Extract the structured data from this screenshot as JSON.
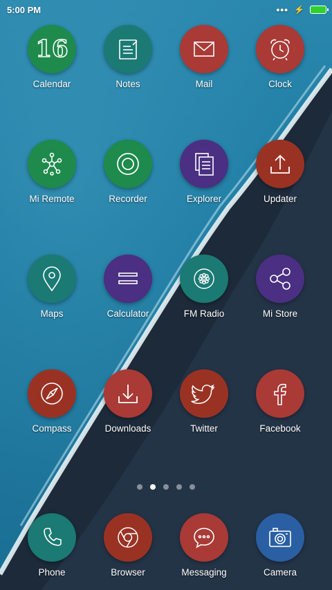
{
  "status_bar": {
    "time": "5:00 PM",
    "more": "•••"
  },
  "apps": [
    {
      "label": "Calendar",
      "icon": "calendar-icon",
      "color": "#1e8a4c",
      "number": "16"
    },
    {
      "label": "Notes",
      "icon": "notes-icon",
      "color": "#1b7a73"
    },
    {
      "label": "Mail",
      "icon": "mail-icon",
      "color": "#a93a36"
    },
    {
      "label": "Clock",
      "icon": "alarm-clock-icon",
      "color": "#a93a36"
    },
    {
      "label": "Mi Remote",
      "icon": "remote-icon",
      "color": "#1e8a4c"
    },
    {
      "label": "Recorder",
      "icon": "recorder-icon",
      "color": "#1e8a4c"
    },
    {
      "label": "Explorer",
      "icon": "files-icon",
      "color": "#4a2f82"
    },
    {
      "label": "Updater",
      "icon": "upload-icon",
      "color": "#9a3224"
    },
    {
      "label": "Maps",
      "icon": "map-pin-icon",
      "color": "#1b7a73"
    },
    {
      "label": "Calculator",
      "icon": "equals-icon",
      "color": "#4a2f82"
    },
    {
      "label": "FM Radio",
      "icon": "radio-icon",
      "color": "#1b7a73"
    },
    {
      "label": "Mi Store",
      "icon": "share-icon",
      "color": "#4a2f82"
    },
    {
      "label": "Compass",
      "icon": "compass-icon",
      "color": "#9a3224"
    },
    {
      "label": "Downloads",
      "icon": "download-icon",
      "color": "#a93a36"
    },
    {
      "label": "Twitter",
      "icon": "twitter-bird-icon",
      "color": "#9a3224"
    },
    {
      "label": "Facebook",
      "icon": "facebook-icon",
      "color": "#a93a36"
    }
  ],
  "pager": {
    "count": 5,
    "active": 1
  },
  "dock": [
    {
      "label": "Phone",
      "icon": "phone-icon",
      "color": "#1b7a73"
    },
    {
      "label": "Browser",
      "icon": "chrome-icon",
      "color": "#9a3224"
    },
    {
      "label": "Messaging",
      "icon": "chat-bubble-icon",
      "color": "#a93a36"
    },
    {
      "label": "Camera",
      "icon": "camera-icon",
      "color": "#2a5fa3"
    }
  ]
}
